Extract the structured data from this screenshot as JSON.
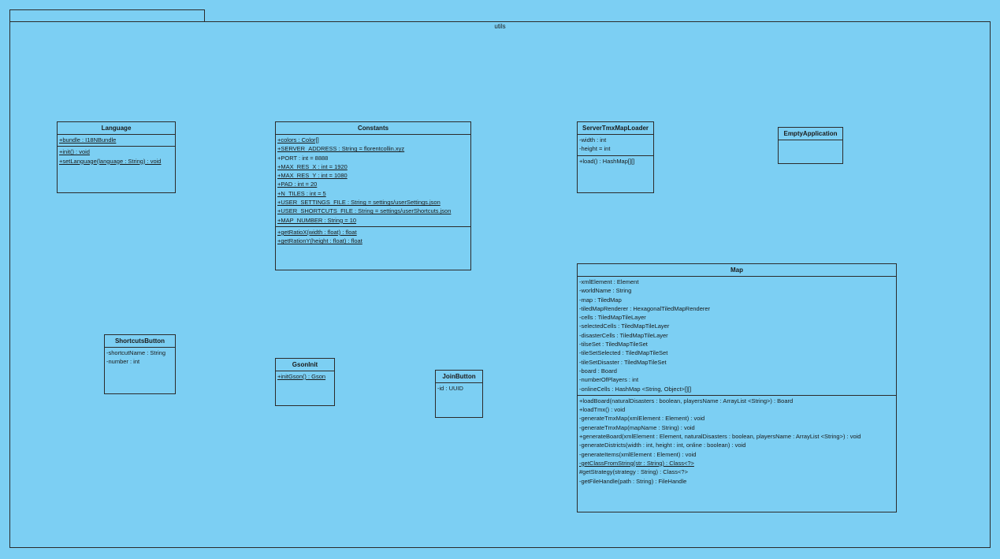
{
  "package": {
    "name": "utils"
  },
  "classes": {
    "language": {
      "name": "Language",
      "attributes": [
        {
          "text": "+bundle : I18NBundle",
          "static": true
        }
      ],
      "operations": [
        {
          "text": "+init() : void",
          "static": true
        },
        {
          "text": "+setLanguage(language : String) : void",
          "static": true
        }
      ]
    },
    "constants": {
      "name": "Constants",
      "attributes": [
        {
          "text": "+colors : Color[]",
          "static": true
        },
        {
          "text": "+SERVER_ADDRESS : String = florentcollin.xyz",
          "static": true
        },
        {
          "text": "+PORT : int = 8888",
          "static": false
        },
        {
          "text": "+MAX_RES_X : int = 1920",
          "static": true
        },
        {
          "text": "+MAX_RES_Y : int = 1080",
          "static": true
        },
        {
          "text": "+PAD : int = 20",
          "static": true
        },
        {
          "text": "+N_TILES : int = 5",
          "static": true
        },
        {
          "text": "+USER_SETTINGS_FILE : String = settings/userSettings.json",
          "static": true
        },
        {
          "text": "+USER_SHORTCUTS_FILE : String = settings/userShortcuts.json",
          "static": true
        },
        {
          "text": "+MAP_NUMBER : String = 10",
          "static": true
        }
      ],
      "operations": [
        {
          "text": "+getRatioX(width : float) : float",
          "static": true
        },
        {
          "text": "+getRationY(height : float) : float",
          "static": true
        }
      ]
    },
    "server_tmx_map_loader": {
      "name": "ServerTmxMapLoader",
      "attributes": [
        {
          "text": "-width : int",
          "static": false
        },
        {
          "text": "-height = int",
          "static": false
        }
      ],
      "operations": [
        {
          "text": "+load() : HashMap[][]",
          "static": false
        }
      ]
    },
    "empty_application": {
      "name": "EmptyApplication",
      "attributes": [],
      "operations": []
    },
    "map": {
      "name": "Map",
      "attributes": [
        {
          "text": "-xmlElement : Element",
          "static": false
        },
        {
          "text": "-worldName : String",
          "static": false
        },
        {
          "text": "-map : TiledMap",
          "static": false
        },
        {
          "text": "-tiledMapRenderer : HexagonalTiledMapRenderer",
          "static": false
        },
        {
          "text": "-cells : TiledMapTileLayer",
          "static": false
        },
        {
          "text": "-selectedCells : TiledMapTileLayer",
          "static": false
        },
        {
          "text": "-disasterCells : TiledMapTileLayer",
          "static": false
        },
        {
          "text": "-tilseSet : TiledMapTileSet",
          "static": false
        },
        {
          "text": "-tileSetSelected : TiledMapTileSet",
          "static": false
        },
        {
          "text": "-tileSetDisaster : TiledMapTileSet",
          "static": false
        },
        {
          "text": "-board : Board",
          "static": false
        },
        {
          "text": "-numberOfPlayers : int",
          "static": false
        },
        {
          "text": "-onlineCells : HashMap <String, Object>[][]",
          "static": false
        }
      ],
      "operations": [
        {
          "text": "+loadBoard(naturalDisasters : boolean, playersName : ArrayList <String>) : Board",
          "static": false
        },
        {
          "text": "+loadTmx() : void",
          "static": false
        },
        {
          "text": "-generateTmxMap(xmlElement : Element) : void",
          "static": false
        },
        {
          "text": "-generateTmxMap(mapName : String) : void",
          "static": false
        },
        {
          "text": "+generateBoard(xmlElement : Element, naturalDisasters : boolean, playersName : ArrayList <String>) : void",
          "static": false
        },
        {
          "text": "-generateDistricts(width : int, height : int, online : boolean) : void",
          "static": false
        },
        {
          "text": "-generateItems(xmlElement : Element) : void",
          "static": false
        },
        {
          "text": "-getClassFromString(str : String) : Class<?>",
          "static": true
        },
        {
          "text": "#getStrategy(strategy : String) : Class<?>",
          "static": false
        },
        {
          "text": "-getFileHandle(path : String) : FileHandle",
          "static": false
        }
      ]
    },
    "shortcuts_button": {
      "name": "ShortcutsButton",
      "attributes": [
        {
          "text": "-shortcutName : String",
          "static": false
        },
        {
          "text": "-number : int",
          "static": false
        }
      ],
      "operations": []
    },
    "gson_init": {
      "name": "GsonInit",
      "attributes": [],
      "operations": [
        {
          "text": "+initGson() : Gson",
          "static": true
        }
      ]
    },
    "join_button": {
      "name": "JoinButton",
      "attributes": [
        {
          "text": "-id : UUID",
          "static": false
        }
      ],
      "operations": []
    }
  },
  "colors": {
    "background": "#7ccff3",
    "border": "#2b2b2b"
  }
}
